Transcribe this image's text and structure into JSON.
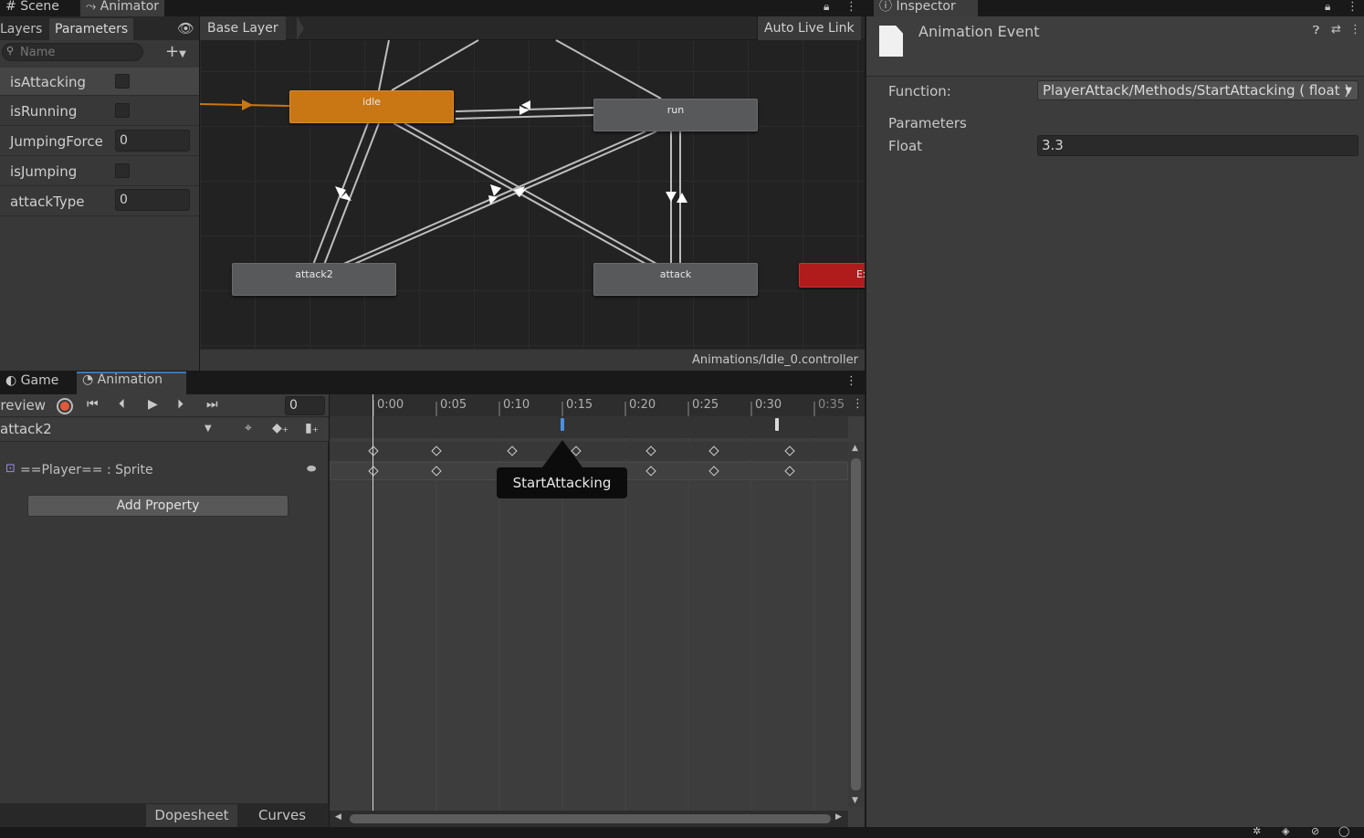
{
  "top_tabs": {
    "scene": "Scene",
    "animator": "Animator"
  },
  "animator": {
    "sub_tabs": {
      "layers": "Layers",
      "parameters": "Parameters"
    },
    "search_placeholder": "Name",
    "breadcrumb": "Base Layer",
    "auto_live_link": "Auto Live Link",
    "controller_path": "Animations/Idle_0.controller",
    "parameters": [
      {
        "name": "isAttacking",
        "type": "bool"
      },
      {
        "name": "isRunning",
        "type": "bool"
      },
      {
        "name": "JumpingForce",
        "type": "float",
        "value": "0"
      },
      {
        "name": "isJumping",
        "type": "bool"
      },
      {
        "name": "attackType",
        "type": "int",
        "value": "0"
      }
    ],
    "states": {
      "idle": "idle",
      "run": "run",
      "attack2": "attack2",
      "attack": "attack",
      "exit": "Exit"
    },
    "colors": {
      "default_state": "#58595b",
      "entry_state": "#c97714",
      "exit_state": "#b01c1c"
    }
  },
  "animation": {
    "tabs": {
      "game": "Game",
      "animation": "Animation"
    },
    "preview_label": "Preview",
    "frame_value": "0",
    "clip_name": "attack2",
    "property_label": "==Player== : Sprite",
    "add_property": "Add Property",
    "timeline_ticks": [
      "0:00",
      "0:05",
      "0:10",
      "0:15",
      "0:20",
      "0:25",
      "0:30",
      "0:35"
    ],
    "event_tooltip": "StartAttacking",
    "bottom_tabs": {
      "dopesheet": "Dopesheet",
      "curves": "Curves"
    }
  },
  "inspector": {
    "tab": "Inspector",
    "title": "Animation Event",
    "function_label": "Function:",
    "function_value": "PlayerAttack/Methods/StartAttacking ( float )",
    "parameters_label": "Parameters",
    "float_label": "Float",
    "float_value": "3.3"
  }
}
